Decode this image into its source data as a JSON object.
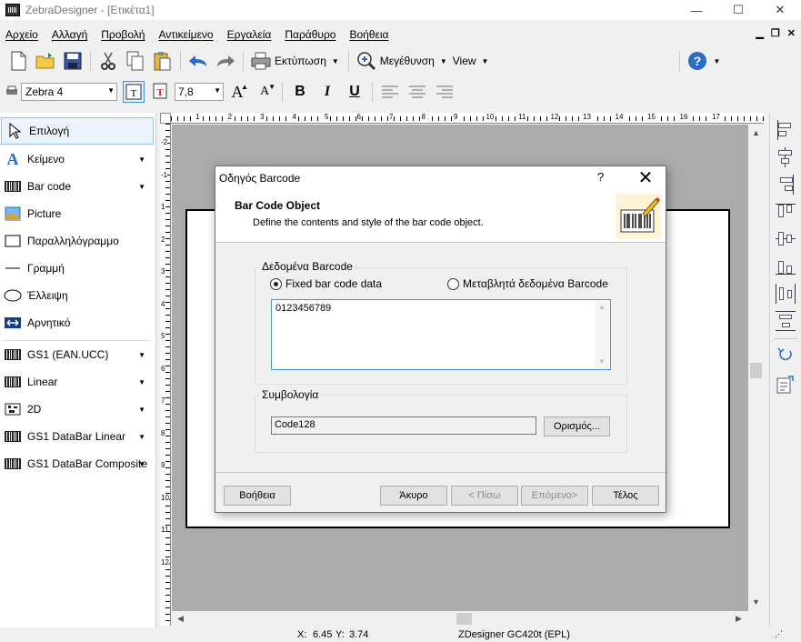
{
  "window": {
    "title": "ZebraDesigner - [Ετικέτα1]",
    "minimize": "—",
    "maximize": "☐",
    "close": "✕"
  },
  "menu": [
    "Αρχείο",
    "Αλλαγή",
    "Προβολή",
    "Αντικείμενο",
    "Εργαλεία",
    "Παράθυρο",
    "Βοήθεια"
  ],
  "toolbar": {
    "print_label": "Εκτύπωση",
    "zoom_label": "Μεγέθυνση",
    "view_label": "View"
  },
  "format": {
    "printer": "Zebra 4",
    "font_size": "7,8"
  },
  "palette": [
    {
      "label": "Επιλογή",
      "icon": "pointer-icon",
      "arrow": false
    },
    {
      "label": "Κείμενο",
      "icon": "text-icon",
      "arrow": true
    },
    {
      "label": "Bar code",
      "icon": "barcode-icon",
      "arrow": true
    },
    {
      "label": "Picture",
      "icon": "picture-icon",
      "arrow": false
    },
    {
      "label": "Παραλληλόγραμμο",
      "icon": "rectangle-icon",
      "arrow": false
    },
    {
      "label": "Γραμμή",
      "icon": "line-icon",
      "arrow": false
    },
    {
      "label": "Έλλειψη",
      "icon": "ellipse-icon",
      "arrow": false
    },
    {
      "label": "Αρνητικό",
      "icon": "inverse-icon",
      "arrow": false
    },
    {
      "label": "GS1 (EAN.UCC)",
      "icon": "barcode-icon",
      "arrow": true
    },
    {
      "label": "Linear",
      "icon": "barcode-icon",
      "arrow": true
    },
    {
      "label": "2D",
      "icon": "2d-barcode-icon",
      "arrow": true
    },
    {
      "label": "GS1 DataBar Linear",
      "icon": "barcode-icon",
      "arrow": true
    },
    {
      "label": "GS1 DataBar Composite",
      "icon": "barcode-icon",
      "arrow": true
    }
  ],
  "ruler": {
    "h": [
      "1",
      "2",
      "3",
      "4",
      "5",
      "6",
      "7",
      "8",
      "9",
      "10",
      "11",
      "12",
      "13",
      "14",
      "15",
      "16",
      "17"
    ],
    "v": [
      "-2",
      "-1",
      "1",
      "2",
      "3",
      "4",
      "5",
      "6",
      "7",
      "8",
      "9",
      "10",
      "11",
      "12"
    ]
  },
  "dialog": {
    "title": "Οδηγός Barcode",
    "help": "?",
    "close": "✕",
    "header_title": "Bar Code Object",
    "header_desc": "Define the contents and style of the bar code object.",
    "data_group": "Δεδομένα Barcode",
    "radio_fixed": "Fixed bar code data",
    "radio_variable": "Μεταβλητά δεδομένα Barcode",
    "data_value": "0123456789",
    "symb_group": "Συμβολογία",
    "symb_value": "Code128",
    "define_btn": "Ορισμός...",
    "help_btn": "Βοήθεια",
    "cancel_btn": "Άκυρο",
    "back_btn": "< Πίσω",
    "next_btn": "Επόμενο>",
    "finish_btn": "Τέλος"
  },
  "status": {
    "x_label": "X:",
    "x_value": "6.45",
    "y_label": "Y:",
    "y_value": "3.74",
    "printer": "ZDesigner GC420t (EPL)"
  }
}
